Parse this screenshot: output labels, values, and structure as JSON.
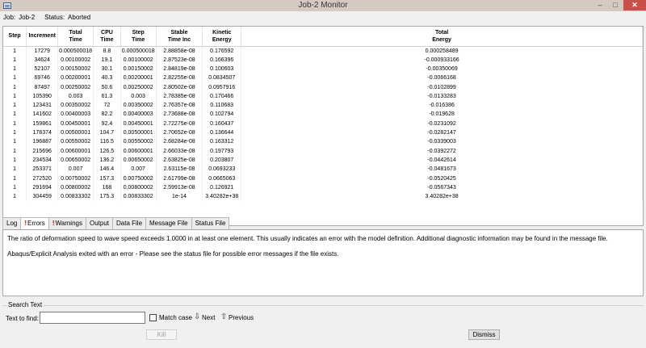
{
  "window": {
    "title": "Job-2 Monitor",
    "minimize_glyph": "–",
    "maximize_glyph": "□",
    "close_glyph": "✕"
  },
  "job": {
    "job_label": "Job:",
    "job_name": "Job-2",
    "status_label": "Status:",
    "status_value": "Aborted"
  },
  "table": {
    "columns": [
      "Step",
      "Increment",
      "Total\nTime",
      "CPU\nTime",
      "Step\nTime",
      "Stable\nTime Inc",
      "Kinetic\nEnergy",
      "Total\nEnergy"
    ],
    "rows": [
      [
        "1",
        "17279",
        "0.000500018",
        "8.8",
        "0.000500018",
        "2.88858e-08",
        "0.176592",
        "0.000258489"
      ],
      [
        "1",
        "34624",
        "0.00100002",
        "19.1",
        "0.00100002",
        "2.87523e-08",
        "0.166396",
        "-0.000933166"
      ],
      [
        "1",
        "52107",
        "0.00150002",
        "30.1",
        "0.00150002",
        "2.84819e-08",
        "0.100603",
        "-0.00350069"
      ],
      [
        "1",
        "69746",
        "0.00200001",
        "40.3",
        "0.00200001",
        "2.82255e-08",
        "0.0834507",
        "-0.0066168"
      ],
      [
        "1",
        "87497",
        "0.00250002",
        "50.6",
        "0.00250002",
        "2.80502e-08",
        "0.0957916",
        "-0.0102899"
      ],
      [
        "1",
        "105390",
        "0.003",
        "61.3",
        "0.003",
        "2.78385e-08",
        "0.170466",
        "-0.0133283"
      ],
      [
        "1",
        "123431",
        "0.00350002",
        "72",
        "0.00350002",
        "2.76357e-08",
        "0.110683",
        "-0.016386"
      ],
      [
        "1",
        "141602",
        "0.00400003",
        "82.2",
        "0.00400003",
        "2.73688e-08",
        "0.102794",
        "-0.019628"
      ],
      [
        "1",
        "159861",
        "0.00450001",
        "92.4",
        "0.00450001",
        "2.72275e-08",
        "0.160437",
        "-0.0231092"
      ],
      [
        "1",
        "178374",
        "0.00500001",
        "104.7",
        "0.00500001",
        "2.70652e-08",
        "0.136644",
        "-0.0282147"
      ],
      [
        "1",
        "196887",
        "0.00550002",
        "116.5",
        "0.00550002",
        "2.68284e-08",
        "0.163312",
        "-0.0339003"
      ],
      [
        "1",
        "215696",
        "0.00600001",
        "126.5",
        "0.00600001",
        "2.66033e-08",
        "0.197793",
        "-0.0392272"
      ],
      [
        "1",
        "234534",
        "0.00650002",
        "136.2",
        "0.00650002",
        "2.63825e-08",
        "0.203807",
        "-0.0442614"
      ],
      [
        "1",
        "253371",
        "0.007",
        "146.4",
        "0.007",
        "2.63115e-08",
        "0.0693233",
        "-0.0481673"
      ],
      [
        "1",
        "272520",
        "0.00750002",
        "157.3",
        "0.00750002",
        "2.61799e-08",
        "0.0665063",
        "-0.0520425"
      ],
      [
        "1",
        "291694",
        "0.00800002",
        "168",
        "0.00800002",
        "2.59913e-08",
        "0.126921",
        "-0.0567343"
      ],
      [
        "1",
        "304459",
        "0.00833302",
        "175.3",
        "0.00833302",
        "1e-14",
        "3.40282e+38",
        "3.40282e+38"
      ]
    ]
  },
  "tabs": [
    {
      "label": "Log",
      "warn": false,
      "active": false
    },
    {
      "label": "Errors",
      "warn": true,
      "active": true
    },
    {
      "label": "Warnings",
      "warn": true,
      "active": false
    },
    {
      "label": "Output",
      "warn": false,
      "active": false
    },
    {
      "label": "Data File",
      "warn": false,
      "active": false
    },
    {
      "label": "Message File",
      "warn": false,
      "active": false
    },
    {
      "label": "Status File",
      "warn": false,
      "active": false
    }
  ],
  "messages": [
    "The ratio of deformation speed to wave speed exceeds 1.0000 in at least one element. This usually indicates an error with the model definition. Additional diagnostic information may be found in the message file.",
    "Abaqus/Explicit Analysis exited with an error - Please see the  status file for possible error messages if the file exists."
  ],
  "search": {
    "group_label": "Search Text",
    "find_label": "Text to find:",
    "find_value": "",
    "match_case_label": "Match case",
    "match_case_checked": false,
    "next_label": "Next",
    "previous_label": "Previous"
  },
  "buttons": {
    "kill": "Kill",
    "dismiss": "Dismiss"
  },
  "colors": {
    "error_marker": "#d40000",
    "close_button": "#c7504b"
  }
}
